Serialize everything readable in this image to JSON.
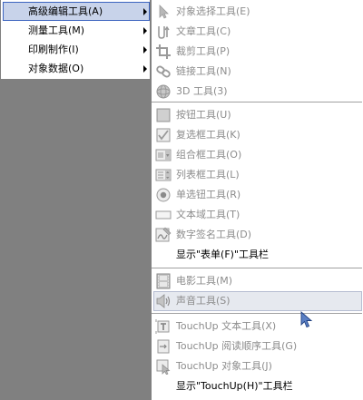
{
  "parent_menu": {
    "items": [
      {
        "label": "高级编辑工具(A)",
        "selected": true
      },
      {
        "label": "测量工具(M)",
        "selected": false
      },
      {
        "label": "印刷制作(I)",
        "selected": false
      },
      {
        "label": "对象数据(O)",
        "selected": false
      }
    ]
  },
  "submenu": {
    "items": [
      {
        "label": "对象选择工具(E)",
        "icon": "select-object-icon",
        "enabled": false
      },
      {
        "label": "文章工具(C)",
        "icon": "article-icon",
        "enabled": false
      },
      {
        "label": "裁剪工具(P)",
        "icon": "crop-icon",
        "enabled": false
      },
      {
        "label": "链接工具(N)",
        "icon": "link-icon",
        "enabled": false
      },
      {
        "label": "3D 工具(3)",
        "icon": "3d-icon",
        "enabled": false
      },
      {
        "label": "按钮工具(U)",
        "icon": "button-tool-icon",
        "enabled": false
      },
      {
        "label": "复选框工具(K)",
        "icon": "checkbox-tool-icon",
        "enabled": false
      },
      {
        "label": "组合框工具(O)",
        "icon": "combobox-tool-icon",
        "enabled": false
      },
      {
        "label": "列表框工具(L)",
        "icon": "listbox-tool-icon",
        "enabled": false
      },
      {
        "label": "单选钮工具(R)",
        "icon": "radio-tool-icon",
        "enabled": false
      },
      {
        "label": "文本域工具(T)",
        "icon": "textfield-tool-icon",
        "enabled": false
      },
      {
        "label": "数字签名工具(D)",
        "icon": "signature-tool-icon",
        "enabled": false
      },
      {
        "label": "显示\"表单(F)\"工具栏",
        "icon": "",
        "enabled": true
      },
      {
        "label": "电影工具(M)",
        "icon": "movie-tool-icon",
        "enabled": false
      },
      {
        "label": "声音工具(S)",
        "icon": "sound-tool-icon",
        "enabled": false
      },
      {
        "label": "TouchUp 文本工具(X)",
        "icon": "touchup-text-icon",
        "enabled": false
      },
      {
        "label": "TouchUp 阅读顺序工具(G)",
        "icon": "touchup-reading-order-icon",
        "enabled": false
      },
      {
        "label": "TouchUp 对象工具(J)",
        "icon": "touchup-object-icon",
        "enabled": false
      },
      {
        "label": "显示\"TouchUp(H)\"工具栏",
        "icon": "",
        "enabled": true
      }
    ]
  }
}
